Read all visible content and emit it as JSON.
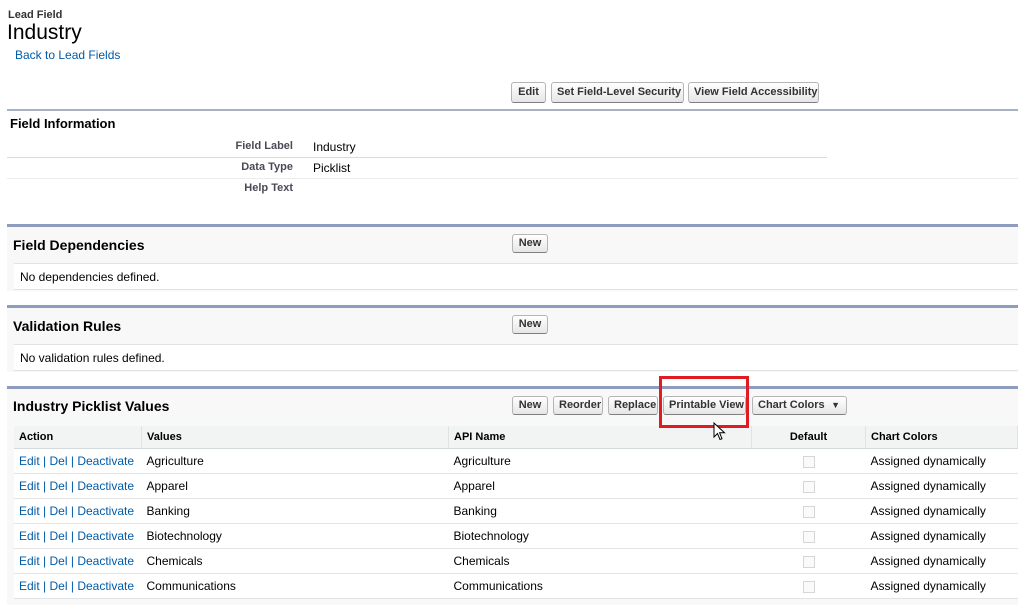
{
  "header": {
    "subtitle": "Lead Field",
    "title": "Industry",
    "back_link": "Back to Lead Fields"
  },
  "top_buttons": {
    "edit": "Edit",
    "field_level_security": "Set Field-Level Security",
    "view_accessibility": "View Field Accessibility"
  },
  "field_info": {
    "section_title": "Field Information",
    "field_label_label": "Field Label",
    "field_label_value": "Industry",
    "data_type_label": "Data Type",
    "data_type_value": "Picklist",
    "help_text_label": "Help Text",
    "help_text_value": ""
  },
  "dependencies": {
    "title": "Field Dependencies",
    "new_button": "New",
    "empty_text": "No dependencies defined."
  },
  "validation": {
    "title": "Validation Rules",
    "new_button": "New",
    "empty_text": "No validation rules defined."
  },
  "picklist": {
    "title": "Industry Picklist Values",
    "buttons": {
      "new": "New",
      "reorder": "Reorder",
      "replace": "Replace",
      "printable_view": "Printable View",
      "chart_colors": "Chart Colors"
    },
    "columns": [
      "Action",
      "Values",
      "API Name",
      "Default",
      "Chart Colors"
    ],
    "action_edit": "Edit",
    "action_del": "Del",
    "action_deactivate": "Deactivate",
    "action_sep": "|",
    "rows": [
      {
        "value": "Agriculture",
        "api_name": "Agriculture",
        "default": false,
        "chart_color": "Assigned dynamically"
      },
      {
        "value": "Apparel",
        "api_name": "Apparel",
        "default": false,
        "chart_color": "Assigned dynamically"
      },
      {
        "value": "Banking",
        "api_name": "Banking",
        "default": false,
        "chart_color": "Assigned dynamically"
      },
      {
        "value": "Biotechnology",
        "api_name": "Biotechnology",
        "default": false,
        "chart_color": "Assigned dynamically"
      },
      {
        "value": "Chemicals",
        "api_name": "Chemicals",
        "default": false,
        "chart_color": "Assigned dynamically"
      },
      {
        "value": "Communications",
        "api_name": "Communications",
        "default": false,
        "chart_color": "Assigned dynamically"
      }
    ]
  },
  "colors": {
    "link": "#015ba7",
    "highlight_box": "#e01b24",
    "panel_border": "#8e9dbe"
  }
}
